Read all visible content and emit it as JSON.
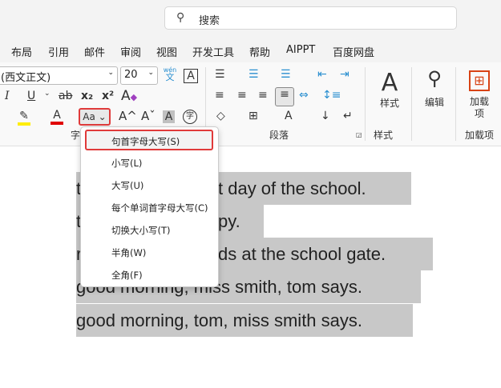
{
  "search": {
    "placeholder": "搜索",
    "icon": "search-icon"
  },
  "tabs": [
    "布局",
    "引用",
    "邮件",
    "审阅",
    "视图",
    "开发工具",
    "帮助",
    "AIPPT",
    "百度网盘"
  ],
  "font": {
    "name": "(西文正文)",
    "size": "20",
    "phonetic_label": "wén",
    "phonetic_char": "文",
    "border_char": "A"
  },
  "format_buttons": {
    "italic": "I",
    "underline": "U",
    "strike": "ab",
    "subscript": "x₂",
    "superscript": "x²",
    "change_case": "Aa",
    "grow": "A^",
    "shrink": "Aˇ",
    "shade": "A",
    "enclose": "字"
  },
  "colors": {
    "highlight": "#ffee00",
    "font_color": "#e00000",
    "accent_red": "#e03a3a",
    "addin": "#d84315",
    "selection": "#c8c8c8"
  },
  "groups": {
    "font": "字",
    "paragraph": "段落",
    "styles": "样式",
    "addins": "加载项"
  },
  "big_buttons": {
    "styles": "样式",
    "edit": "编辑",
    "addins": "加载项"
  },
  "case_menu": [
    {
      "label": "句首字母大写(S)",
      "selected": true
    },
    {
      "label": "小写(L)"
    },
    {
      "label": "大写(U)"
    },
    {
      "label": "每个单词首字母大写(C)"
    },
    {
      "label": "切换大小写(T)"
    },
    {
      "label": "半角(W)"
    },
    {
      "label": "全角(F)"
    }
  ],
  "document": {
    "lines": [
      {
        "start": "t",
        "rest": "t day of the school."
      },
      {
        "start": "t",
        "rest": "py."
      },
      {
        "start": "r",
        "rest": "ds at the school gate."
      },
      {
        "start": "good morning, miss smith, tom says.",
        "rest": ""
      },
      {
        "start": "good morning, tom, miss smith says.",
        "rest": ""
      }
    ]
  }
}
